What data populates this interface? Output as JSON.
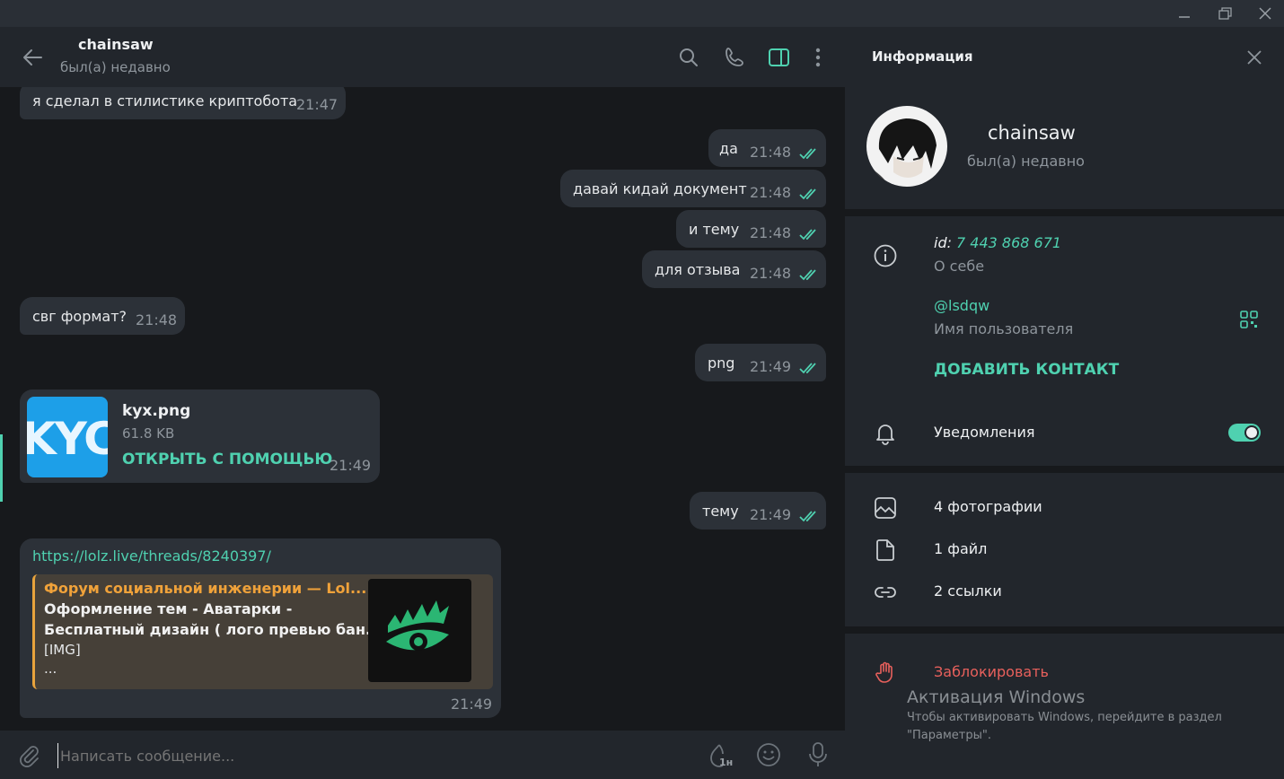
{
  "chat": {
    "name": "chainsaw",
    "status": "был(а) недавно"
  },
  "messages": [
    {
      "dir": "in",
      "text": "я сделал в стилистике криптобота",
      "time": "21:47"
    },
    {
      "dir": "out",
      "text": "да",
      "time": "21:48"
    },
    {
      "dir": "out",
      "text": "давай кидай документ",
      "time": "21:48"
    },
    {
      "dir": "out",
      "text": "и тему",
      "time": "21:48"
    },
    {
      "dir": "out",
      "text": "для отзыва",
      "time": "21:48"
    },
    {
      "dir": "in",
      "text": "свг формат?",
      "time": "21:48"
    },
    {
      "dir": "out",
      "text": "png",
      "time": "21:49"
    },
    {
      "dir": "out",
      "text": "тему",
      "time": "21:49"
    }
  ],
  "file_message": {
    "name": "kyx.png",
    "size": "61.8 KB",
    "action": "ОТКРЫТЬ С ПОМОЩЬЮ",
    "time": "21:49",
    "thumb_text": "KYC"
  },
  "link_message": {
    "url": "https://lolz.live/threads/8240397/",
    "site": "Форум социальной инженерии — Lol...",
    "line1": "Оформление тем - Аватарки -",
    "line2": "Бесплатный дизайн ( лого превью бан...",
    "line3": "[IMG]",
    "line4": "...",
    "time": "21:49"
  },
  "composer": {
    "placeholder": "Написать сообщение...",
    "schedule_badge": "1н"
  },
  "info": {
    "title": "Информация",
    "name": "chainsaw",
    "status": "был(а) недавно",
    "id_label": "id:",
    "id_value": "7 443 868 671",
    "about_label": "О себе",
    "username": "@lsdqw",
    "username_label": "Имя пользователя",
    "add_contact": "ДОБАВИТЬ КОНТАКТ",
    "notifications": "Уведомления",
    "notifications_on": true,
    "photos": "4 фотографии",
    "files": "1 файл",
    "links": "2 ссылки",
    "block": "Заблокировать"
  },
  "watermark": {
    "title": "Активация Windows",
    "line1": "Чтобы активировать Windows, перейдите в раздел",
    "line2": "\"Параметры\"."
  },
  "colors": {
    "accent": "#4fd1b0",
    "link_card_accent": "#e8a33c",
    "danger": "#e8605c"
  }
}
